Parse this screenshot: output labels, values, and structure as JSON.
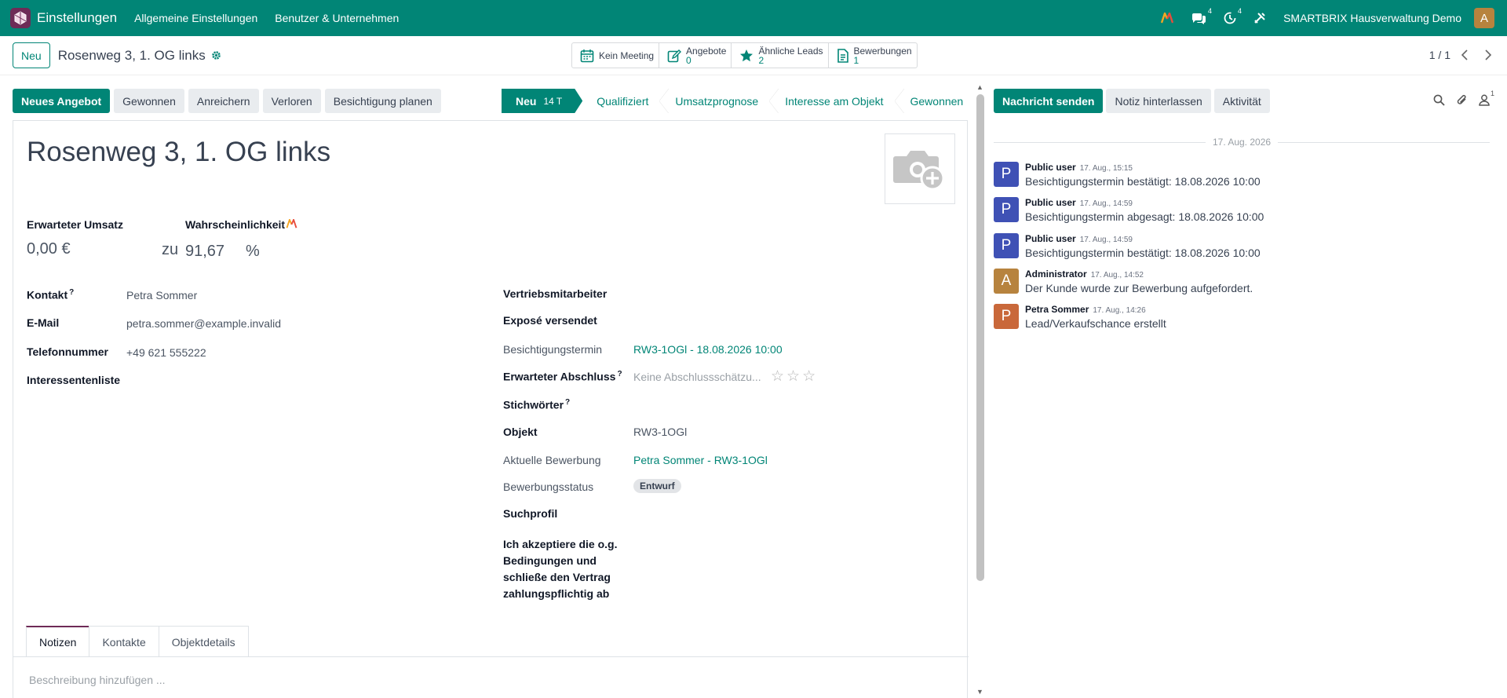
{
  "navbar": {
    "app_name": "Einstellungen",
    "menu": [
      "Allgemeine Einstellungen",
      "Benutzer & Unternehmen"
    ],
    "messages_count": "4",
    "activities_count": "4",
    "company": "SMARTBRIX Hausverwaltung Demo",
    "user_initial": "A"
  },
  "control": {
    "new_label": "Neu",
    "record_title": "Rosenweg 3, 1. OG links",
    "pager": "1 / 1",
    "smart_buttons": [
      {
        "label": "Kein Meeting",
        "value": ""
      },
      {
        "label": "Angebote",
        "value": "0"
      },
      {
        "label": "Ähnliche Leads",
        "value": "2"
      },
      {
        "label": "Bewerbungen",
        "value": "1"
      }
    ]
  },
  "actions": [
    "Neues Angebot",
    "Gewonnen",
    "Anreichern",
    "Verloren",
    "Besichtigung planen"
  ],
  "stages": {
    "active": {
      "label": "Neu",
      "count": "14 T"
    },
    "others": [
      "Qualifiziert",
      "Umsatzprognose",
      "Interesse am Objekt",
      "Gewonnen"
    ]
  },
  "form": {
    "name": "Rosenweg 3, 1. OG links",
    "expected_revenue_label": "Erwarteter Umsatz",
    "expected_revenue": "0,00 €",
    "probability_label": "Wahrscheinlichkeit",
    "at": "zu",
    "probability": "91,67",
    "percent": "%",
    "left": [
      {
        "label": "Kontakt",
        "help": "?",
        "value": "Petra Sommer"
      },
      {
        "label": "E-Mail",
        "value": "petra.sommer@example.invalid"
      },
      {
        "label": "Telefonnummer",
        "value": "+49 621 555222"
      },
      {
        "label": "Interessentenliste",
        "value": ""
      }
    ],
    "right": {
      "salesperson": "Vertriebsmitarbeiter",
      "expose_sent": "Exposé versendet",
      "viewing_label": "Besichtigungstermin",
      "viewing_value": "RW3-1OGl - 18.08.2026 10:00",
      "expected_close_label": "Erwarteter Abschluss",
      "expected_close_help": "?",
      "expected_close_placeholder": "Keine Abschlussschätzu...",
      "tags_label": "Stichwörter",
      "tags_help": "?",
      "object_label": "Objekt",
      "object_value": "RW3-1OGl",
      "application_label": "Aktuelle Bewerbung",
      "application_value": "Petra Sommer - RW3-1OGl",
      "application_status_label": "Bewerbungsstatus",
      "application_status_value": "Entwurf",
      "search_profile_label": "Suchprofil",
      "accept_line1": "Ich akzeptiere die o.g.",
      "accept_line2": "Bedingungen und",
      "accept_line3": "schließe den Vertrag",
      "accept_line4": "zahlungspflichtig ab"
    },
    "tabs": [
      "Notizen",
      "Kontakte",
      "Objektdetails"
    ],
    "description_placeholder": "Beschreibung hinzufügen ..."
  },
  "chatter": {
    "buttons": [
      "Nachricht senden",
      "Notiz hinterlassen",
      "Aktivität"
    ],
    "followers_count": "1",
    "date_separator": "17. Aug. 2026",
    "messages": [
      {
        "initial": "P",
        "color": "#3f51b5",
        "author": "Public user",
        "date": "17. Aug., 15:15",
        "body": "Besichtigungstermin bestätigt: 18.08.2026 10:00"
      },
      {
        "initial": "P",
        "color": "#3f51b5",
        "author": "Public user",
        "date": "17. Aug., 14:59",
        "body": "Besichtigungstermin abgesagt: 18.08.2026 10:00"
      },
      {
        "initial": "P",
        "color": "#3f51b5",
        "author": "Public user",
        "date": "17. Aug., 14:59",
        "body": "Besichtigungstermin bestätigt: 18.08.2026 10:00"
      },
      {
        "initial": "A",
        "color": "#b7833e",
        "author": "Administrator",
        "date": "17. Aug., 14:52",
        "body": "Der Kunde wurde zur Bewerbung aufgefordert."
      },
      {
        "initial": "P",
        "color": "#c9683a",
        "author": "Petra Sommer",
        "date": "17. Aug., 14:26",
        "body": "Lead/Verkaufschance erstellt"
      }
    ]
  },
  "colors": {
    "primary": "#018576",
    "navbar": "#018576",
    "brand": "#6e2b57"
  }
}
